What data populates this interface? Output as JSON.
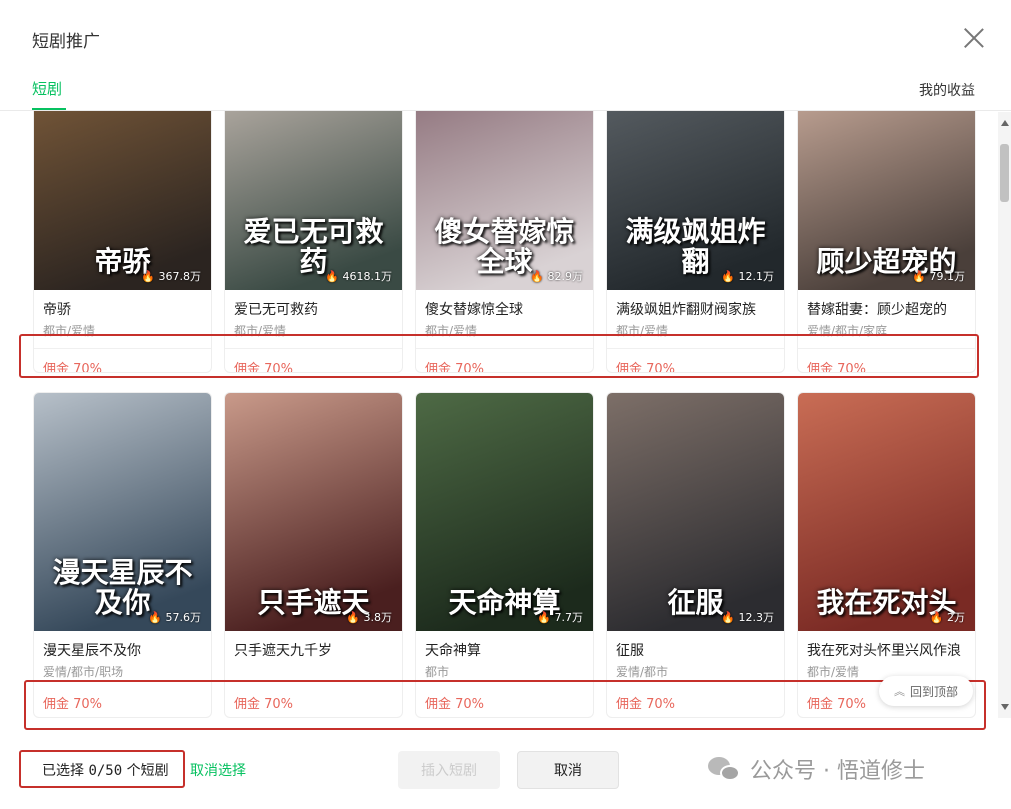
{
  "dialog": {
    "title": "短剧推广"
  },
  "tabs": {
    "active": "短剧",
    "earnings": "我的收益"
  },
  "cards": [
    {
      "name": "帝骄",
      "genre": "都市/爱情",
      "views": "367.8万",
      "poster_text": "帝骄",
      "commission": "佣金 70%",
      "colors": [
        "#2b2420",
        "#7a5a3a"
      ]
    },
    {
      "name": "爱已无可救药",
      "genre": "都市/爱情",
      "views": "4618.1万",
      "poster_text": "爱已无可救药",
      "commission": "佣金 70%",
      "colors": [
        "#3a4a44",
        "#b9b0a8"
      ]
    },
    {
      "name": "傻女替嫁惊全球",
      "genre": "都市/爱情",
      "views": "82.9万",
      "poster_text": "傻女替嫁惊全球",
      "commission": "佣金 70%",
      "colors": [
        "#d9d2d4",
        "#8c6f78"
      ]
    },
    {
      "name": "满级飒姐炸翻财阀家族",
      "genre": "都市/爱情",
      "views": "12.1万",
      "poster_text": "满级飒姐炸翻",
      "commission": "佣金 70%",
      "colors": [
        "#22282c",
        "#5b6166"
      ]
    },
    {
      "name": "替嫁甜妻：顾少超宠的",
      "genre": "爱情/都市/家庭",
      "views": "79.1万",
      "poster_text": "顾少超宠的",
      "commission": "佣金 70%",
      "colors": [
        "#4a3f3a",
        "#c7a99a"
      ]
    },
    {
      "name": "漫天星辰不及你",
      "genre": "爱情/都市/职场",
      "views": "57.6万",
      "poster_text": "漫天星辰不及你",
      "commission": "佣金 70%",
      "colors": [
        "#35485a",
        "#b7c0c9"
      ]
    },
    {
      "name": "只手遮天九千岁",
      "genre": "",
      "views": "3.8万",
      "poster_text": "只手遮天",
      "commission": "佣金 70%",
      "colors": [
        "#4a1f1f",
        "#c99a8a"
      ]
    },
    {
      "name": "天命神算",
      "genre": "都市",
      "views": "7.7万",
      "poster_text": "天命神算",
      "commission": "佣金 70%",
      "colors": [
        "#1c2a1c",
        "#4e6a45"
      ]
    },
    {
      "name": "征服",
      "genre": "爱情/都市",
      "views": "12.3万",
      "poster_text": "征服",
      "commission": "佣金 70%",
      "colors": [
        "#2c2c30",
        "#7d6f68"
      ]
    },
    {
      "name": "我在死对头怀里兴风作浪",
      "genre": "都市/爱情",
      "views": "2万",
      "poster_text": "我在死对头",
      "commission": "佣金 70%",
      "colors": [
        "#7a2a24",
        "#c96d55"
      ]
    }
  ],
  "back_to_top": "回到顶部",
  "footer": {
    "selected_prefix": "已选择 ",
    "selected_count": "0/50",
    "selected_suffix": " 个短剧",
    "deselect": "取消选择",
    "insert": "插入短剧",
    "cancel": "取消"
  },
  "watermark": "公众号 · 悟道修士",
  "colors": {
    "accent": "#07c160",
    "commission": "#e8675c",
    "annotation": "#c6302b"
  }
}
